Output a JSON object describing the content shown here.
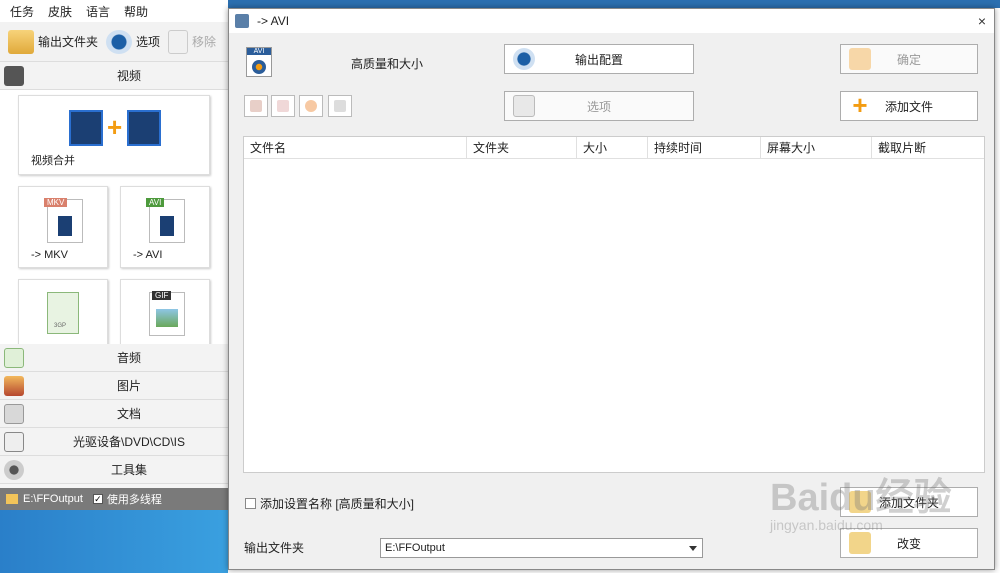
{
  "menu": [
    "任务",
    "皮肤",
    "语言",
    "帮助"
  ],
  "toolbar": {
    "output_folder": "输出文件夹",
    "options": "选项",
    "remove": "移除"
  },
  "categories": {
    "video": "视频",
    "audio": "音频",
    "picture": "图片",
    "document": "文档",
    "disc": "光驱设备\\DVD\\CD\\IS",
    "tools": "工具集"
  },
  "tiles": {
    "merge": "视频合并",
    "mkv": "-> MKV",
    "avi": "-> AVI",
    "mkv_badge": "MKV",
    "avi_badge": "AVI",
    "gif_badge": "GIF",
    "three_gp_badge": "3GP"
  },
  "statusbar": {
    "path": "E:\\FFOutput",
    "multithread": "使用多线程"
  },
  "dialog": {
    "title": "-> AVI",
    "close": "×",
    "format_badge": "AVI",
    "quality": "高质量和大小",
    "output_config": "输出配置",
    "options": "选项",
    "ok": "确定",
    "add_file": "添加文件",
    "columns": [
      "文件名",
      "文件夹",
      "大小",
      "持续时间",
      "屏幕大小",
      "截取片断"
    ],
    "add_setting_name": "添加设置名称 [高质量和大小]",
    "add_folder": "添加文件夹",
    "change": "改变",
    "output_folder_label": "输出文件夹",
    "output_folder_value": "E:\\FFOutput"
  },
  "watermark": {
    "main": "Baidu经验",
    "sub": "jingyan.baidu.com"
  },
  "colors": {
    "accent_orange": "#f39c12",
    "desktop_blue": "#2a7fc9"
  }
}
